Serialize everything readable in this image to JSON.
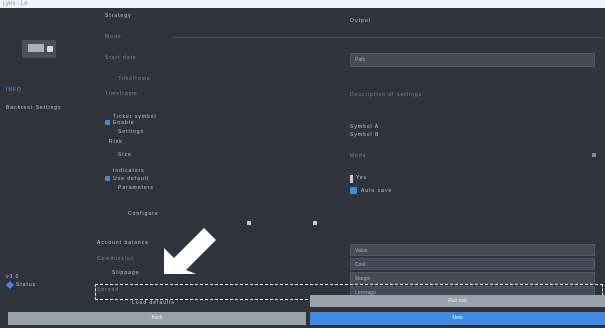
{
  "window": {
    "title": "Lynx - Le"
  },
  "sidebar": {
    "section_label": "INFO",
    "item_label": "Backtest Settings",
    "footer_label_1": "v3.0",
    "footer_label_2": "Status",
    "footer_icon": "diamond-icon",
    "logo_icon": "monitor-icon"
  },
  "left": {
    "header_top": "Strategy",
    "header_sub": "Mode",
    "group1_title": "Start date",
    "group1_sub": "Timeframe",
    "group2_title": "Ticker symbol",
    "group2_check": "Enable",
    "group2_line1": "Settings",
    "group2_line2": "Risk",
    "group2_line3": "Size",
    "group3_title": "Indicators",
    "group3_check": "Use default",
    "group3_line": "Parameters",
    "center_text": "Configure",
    "row_a_label": "Account balance",
    "row_b_label": "Commission",
    "row_c_label": "Slippage",
    "row_d_label": "Spread",
    "bottom_text": "Load defaults"
  },
  "right": {
    "header_label": "Output",
    "input_placeholder": "Path",
    "desc_label": "Description of settings",
    "pair_label_1": "Symbol A",
    "pair_label_2": "Symbol B",
    "misc_label": "Mode",
    "check1_label": "Yes",
    "check2_label": "Auto save",
    "field_e_label": "Value",
    "field_f_label": "Cost",
    "field_g_label": "Margin",
    "field_h_label": "Leverage",
    "grey_button": "Run test"
  },
  "footer": {
    "back_label": "Back",
    "next_label": "Next"
  },
  "colors": {
    "background": "#2f343c",
    "accent": "#3d8ae6",
    "button_grey": "#98a0aa"
  }
}
